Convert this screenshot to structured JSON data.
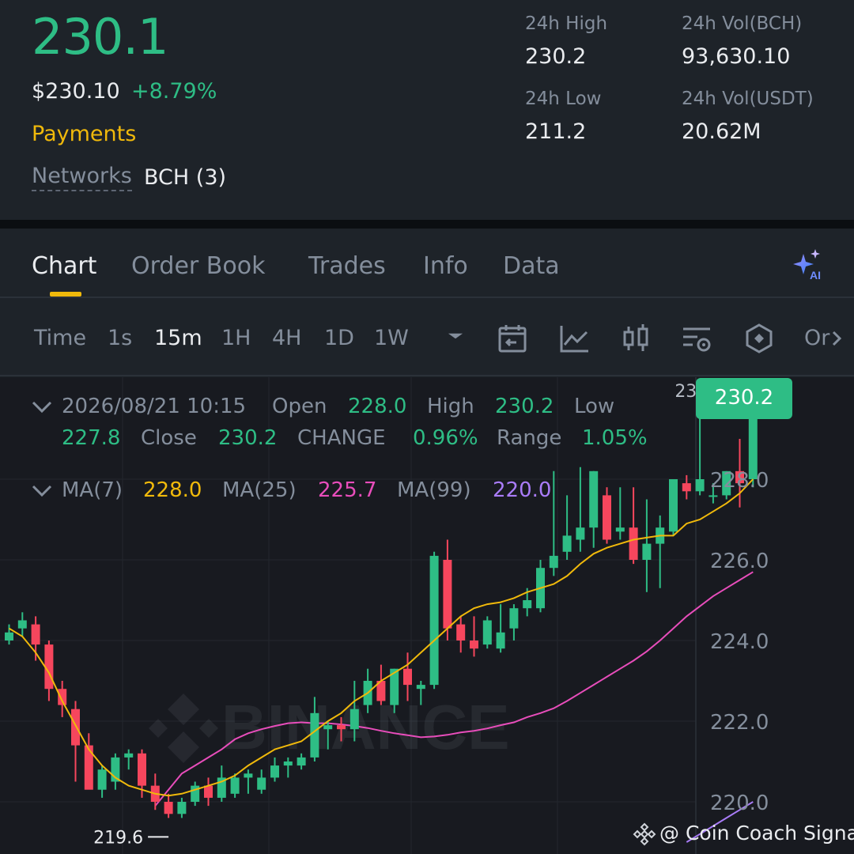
{
  "ticker": {
    "last_price": "230.1",
    "usd_price": "$230.10",
    "change_percent": "+8.79%",
    "category": "Payments",
    "networks_label": "Networks",
    "networks_value": "BCH (3)"
  },
  "stats": {
    "high_label": "24h High",
    "high_value": "230.2",
    "vol_base_label": "24h Vol(BCH)",
    "vol_base_value": "93,630.10",
    "low_label": "24h Low",
    "low_value": "211.2",
    "vol_quote_label": "24h Vol(USDT)",
    "vol_quote_value": "20.62M"
  },
  "tabs": [
    {
      "label": "Chart",
      "active": true
    },
    {
      "label": "Order Book",
      "active": false
    },
    {
      "label": "Trades",
      "active": false
    },
    {
      "label": "Info",
      "active": false
    },
    {
      "label": "Data",
      "active": false
    }
  ],
  "ai_icon": "sparkle-ai-icon",
  "timeframes": [
    {
      "label": "Time",
      "active": false
    },
    {
      "label": "1s",
      "active": false
    },
    {
      "label": "15m",
      "active": true
    },
    {
      "label": "1H",
      "active": false
    },
    {
      "label": "4H",
      "active": false
    },
    {
      "label": "1D",
      "active": false
    },
    {
      "label": "1W",
      "active": false
    }
  ],
  "toolbar_icons": [
    "dropdown-caret-icon",
    "calendar-back-icon",
    "line-chart-icon",
    "candle-settings-icon",
    "indicator-settings-icon",
    "hexagon-icon",
    "more-icon"
  ],
  "toolbar_more_label": "Or",
  "ohlc": {
    "datetime": "2026/08/21 10:15",
    "open_label": "Open",
    "open": "228.0",
    "high_label": "High",
    "high": "230.2",
    "low_label": "Low",
    "low": "227.8",
    "close_label": "Close",
    "close": "230.2",
    "change_label": "CHANGE",
    "change": "0.96%",
    "range_label": "Range",
    "range": "1.05%"
  },
  "ma": {
    "ma7_label": "MA(7)",
    "ma7": "228.0",
    "ma25_label": "MA(25)",
    "ma25": "225.7",
    "ma99_label": "MA(99)",
    "ma99": "220.0"
  },
  "colors": {
    "up": "#2ebd85",
    "down": "#f6465d",
    "accent": "#f0b90b",
    "ma7": "#f0b90b",
    "ma25": "#e84dbb",
    "ma99": "#a97cf8"
  },
  "watermark": "BINANCE",
  "credit": "@ Coin Coach Signals",
  "chart_data": {
    "type": "candlestick",
    "interval": "15m",
    "y_ticks": [
      "228.0",
      "226.0",
      "224.0",
      "222.0",
      "220.0"
    ],
    "ylim": [
      219.0,
      230.5
    ],
    "current_price_tag": "230.2",
    "high_marker": "230.2",
    "low_marker": "219.6",
    "candles": [
      [
        224.0,
        224.4,
        223.9,
        224.2
      ],
      [
        224.3,
        224.7,
        224.1,
        224.5
      ],
      [
        224.4,
        224.6,
        223.5,
        223.9
      ],
      [
        223.9,
        224.0,
        222.5,
        222.8
      ],
      [
        222.8,
        223.0,
        222.1,
        222.4
      ],
      [
        222.3,
        222.5,
        220.5,
        221.4
      ],
      [
        221.4,
        221.7,
        220.5,
        220.3
      ],
      [
        220.3,
        220.9,
        220.1,
        220.8
      ],
      [
        220.5,
        221.2,
        220.3,
        221.1
      ],
      [
        221.1,
        221.3,
        220.8,
        221.2
      ],
      [
        221.2,
        221.3,
        220.1,
        220.4
      ],
      [
        220.4,
        220.7,
        219.8,
        220.0
      ],
      [
        220.0,
        220.2,
        219.6,
        219.7
      ],
      [
        219.7,
        220.1,
        219.6,
        220.0
      ],
      [
        220.0,
        220.5,
        219.9,
        220.4
      ],
      [
        220.4,
        220.6,
        219.9,
        220.1
      ],
      [
        220.1,
        220.9,
        220.0,
        220.6
      ],
      [
        220.2,
        220.7,
        220.1,
        220.6
      ],
      [
        220.6,
        220.8,
        220.2,
        220.7
      ],
      [
        220.3,
        220.8,
        220.2,
        220.6
      ],
      [
        220.6,
        221.1,
        220.5,
        220.9
      ],
      [
        220.9,
        221.1,
        220.6,
        221.0
      ],
      [
        220.9,
        221.2,
        220.8,
        221.1
      ],
      [
        221.1,
        222.6,
        221.0,
        222.2
      ],
      [
        221.8,
        222.0,
        221.3,
        221.9
      ],
      [
        221.9,
        222.1,
        221.5,
        221.8
      ],
      [
        221.8,
        223.0,
        221.5,
        222.3
      ],
      [
        222.4,
        223.3,
        222.2,
        223.0
      ],
      [
        223.0,
        223.4,
        222.4,
        222.5
      ],
      [
        222.4,
        223.3,
        222.2,
        223.3
      ],
      [
        223.3,
        223.7,
        222.5,
        222.9
      ],
      [
        222.8,
        223.0,
        222.4,
        222.9
      ],
      [
        222.9,
        226.2,
        222.8,
        226.1
      ],
      [
        226.0,
        226.5,
        224.0,
        224.3
      ],
      [
        224.4,
        224.6,
        223.7,
        224.0
      ],
      [
        224.0,
        224.6,
        223.6,
        223.8
      ],
      [
        223.9,
        224.6,
        223.8,
        224.5
      ],
      [
        223.8,
        224.9,
        223.7,
        224.2
      ],
      [
        224.3,
        224.9,
        224.0,
        224.8
      ],
      [
        224.8,
        225.3,
        224.6,
        225.0
      ],
      [
        224.8,
        226.0,
        224.7,
        225.8
      ],
      [
        225.8,
        228.2,
        225.6,
        226.1
      ],
      [
        226.2,
        227.6,
        226.0,
        226.6
      ],
      [
        226.5,
        228.3,
        226.2,
        226.8
      ],
      [
        226.8,
        228.2,
        226.3,
        228.2
      ],
      [
        227.6,
        227.8,
        226.4,
        226.5
      ],
      [
        226.7,
        227.8,
        226.5,
        226.8
      ],
      [
        226.8,
        227.8,
        225.9,
        226.0
      ],
      [
        226.0,
        227.5,
        225.2,
        226.4
      ],
      [
        226.4,
        227.1,
        225.3,
        226.8
      ],
      [
        226.7,
        228.0,
        226.6,
        228.0
      ],
      [
        227.9,
        228.1,
        227.5,
        227.7
      ],
      [
        227.7,
        229.6,
        227.6,
        228.0
      ],
      [
        227.6,
        227.9,
        227.4,
        227.6
      ],
      [
        227.6,
        228.2,
        227.5,
        228.2
      ],
      [
        228.2,
        229.0,
        227.3,
        227.9
      ],
      [
        228.0,
        230.2,
        227.8,
        230.2
      ]
    ],
    "ma7": [
      224.3,
      224.1,
      223.7,
      223.2,
      222.5,
      221.9,
      221.3,
      220.9,
      220.6,
      220.4,
      220.3,
      220.2,
      220.15,
      220.2,
      220.3,
      220.4,
      220.5,
      220.65,
      220.9,
      221.1,
      221.3,
      221.4,
      221.5,
      221.75,
      222.0,
      222.2,
      222.5,
      222.7,
      223.0,
      223.2,
      223.4,
      223.7,
      224.0,
      224.3,
      224.6,
      224.8,
      224.9,
      224.95,
      225.05,
      225.2,
      225.3,
      225.4,
      225.6,
      225.9,
      226.15,
      226.3,
      226.4,
      226.5,
      226.55,
      226.6,
      226.6,
      226.9,
      227.0,
      227.2,
      227.4,
      227.65,
      228.0
    ],
    "ma25": [
      219.9,
      220.3,
      220.7,
      220.9,
      221.1,
      221.3,
      221.55,
      221.7,
      221.8,
      221.88,
      221.95,
      221.97,
      221.95,
      221.95,
      221.92,
      221.88,
      221.83,
      221.76,
      221.7,
      221.65,
      221.6,
      221.62,
      221.66,
      221.72,
      221.76,
      221.82,
      221.9,
      221.97,
      222.1,
      222.2,
      222.32,
      222.5,
      222.7,
      222.9,
      223.1,
      223.3,
      223.5,
      223.73,
      224.0,
      224.3,
      224.6,
      224.85,
      225.1,
      225.3,
      225.5,
      225.7
    ],
    "ma99": [
      219.0,
      219.2,
      219.4,
      219.6,
      219.8,
      220.0
    ]
  }
}
